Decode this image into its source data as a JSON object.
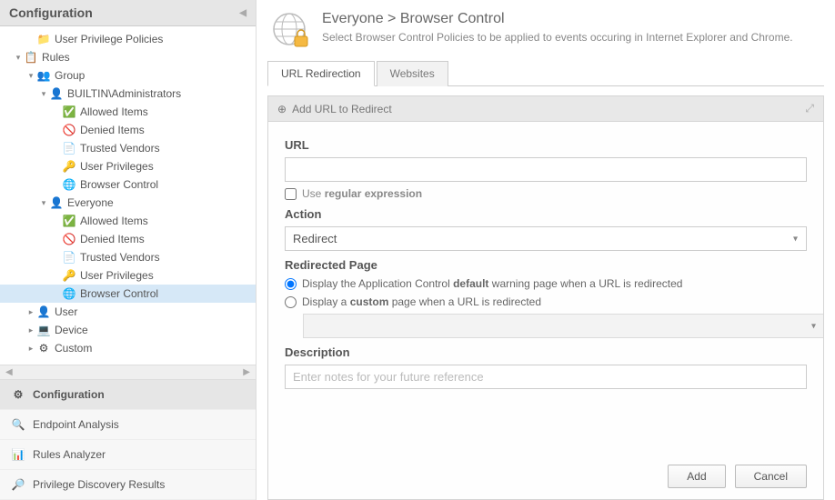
{
  "sidebar": {
    "title": "Configuration",
    "tree": [
      {
        "label": "User Privilege Policies",
        "icon": "folder",
        "indent": 2,
        "toggle": ""
      },
      {
        "label": "Rules",
        "icon": "rules",
        "indent": 1,
        "toggle": "▾"
      },
      {
        "label": "Group",
        "icon": "group",
        "indent": 2,
        "toggle": "▾"
      },
      {
        "label": "BUILTIN\\Administrators",
        "icon": "users",
        "indent": 3,
        "toggle": "▾"
      },
      {
        "label": "Allowed Items",
        "icon": "allow",
        "indent": 4,
        "toggle": ""
      },
      {
        "label": "Denied Items",
        "icon": "deny",
        "indent": 4,
        "toggle": ""
      },
      {
        "label": "Trusted Vendors",
        "icon": "vendor",
        "indent": 4,
        "toggle": ""
      },
      {
        "label": "User Privileges",
        "icon": "priv",
        "indent": 4,
        "toggle": ""
      },
      {
        "label": "Browser Control",
        "icon": "browser",
        "indent": 4,
        "toggle": ""
      },
      {
        "label": "Everyone",
        "icon": "users",
        "indent": 3,
        "toggle": "▾"
      },
      {
        "label": "Allowed Items",
        "icon": "allow",
        "indent": 4,
        "toggle": ""
      },
      {
        "label": "Denied Items",
        "icon": "deny",
        "indent": 4,
        "toggle": ""
      },
      {
        "label": "Trusted Vendors",
        "icon": "vendor",
        "indent": 4,
        "toggle": ""
      },
      {
        "label": "User Privileges",
        "icon": "priv",
        "indent": 4,
        "toggle": ""
      },
      {
        "label": "Browser Control",
        "icon": "browser",
        "indent": 4,
        "toggle": "",
        "selected": true
      },
      {
        "label": "User",
        "icon": "user",
        "indent": 2,
        "toggle": "▸"
      },
      {
        "label": "Device",
        "icon": "device",
        "indent": 2,
        "toggle": "▸"
      },
      {
        "label": "Custom",
        "icon": "custom",
        "indent": 2,
        "toggle": "▸"
      }
    ],
    "nav": [
      {
        "label": "Configuration",
        "icon": "gear",
        "active": true
      },
      {
        "label": "Endpoint Analysis",
        "icon": "analysis"
      },
      {
        "label": "Rules Analyzer",
        "icon": "ranalyzer"
      },
      {
        "label": "Privilege Discovery Results",
        "icon": "discovery"
      }
    ]
  },
  "main": {
    "breadcrumb": "Everyone > Browser Control",
    "description": "Select Browser Control Policies to be applied to events occuring in Internet Explorer and Chrome.",
    "tabs": [
      {
        "label": "URL Redirection",
        "active": true
      },
      {
        "label": "Websites"
      }
    ],
    "panel": {
      "title": "Add URL to Redirect",
      "url_label": "URL",
      "url_value": "",
      "regex_label": "Use regular expression",
      "action_label": "Action",
      "action_value": "Redirect",
      "redirected_label": "Redirected Page",
      "radio_default": "Display the Application Control default warning page when a URL is redirected",
      "radio_custom": "Display a custom page when a URL is redirected",
      "description_label": "Description",
      "description_placeholder": "Enter notes for your future reference",
      "btn_add": "Add",
      "btn_cancel": "Cancel"
    }
  },
  "icons": {
    "folder": "📁",
    "rules": "📋",
    "group": "👥",
    "users": "👤",
    "allow": "✅",
    "deny": "🚫",
    "vendor": "📄",
    "priv": "🔑",
    "browser": "🌐",
    "user": "👤",
    "device": "💻",
    "custom": "⚙",
    "gear": "⚙",
    "analysis": "🔍",
    "ranalyzer": "📊",
    "discovery": "🔎"
  }
}
